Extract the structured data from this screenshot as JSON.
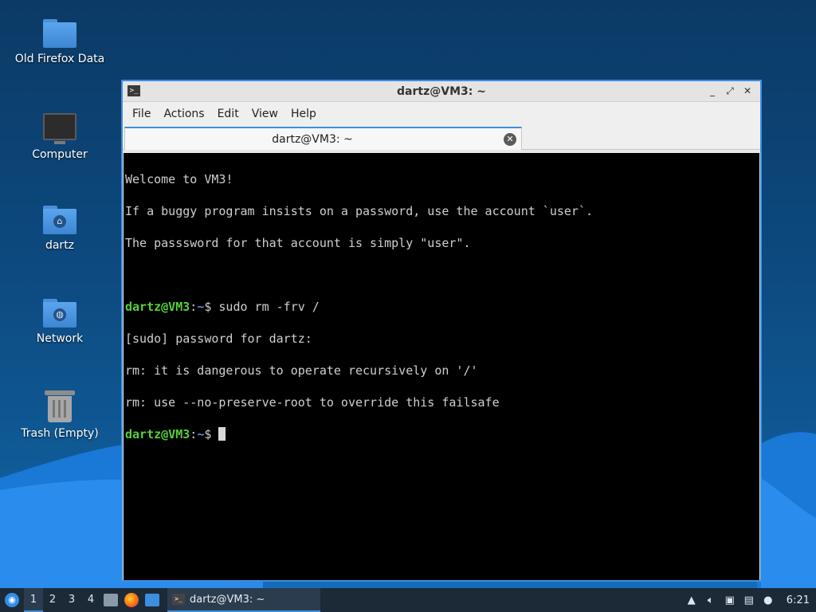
{
  "desktop": {
    "icons": [
      {
        "label": "Old Firefox Data",
        "icon": "folder-icon"
      },
      {
        "label": "Computer",
        "icon": "computer-icon"
      },
      {
        "label": "dartz",
        "icon": "home-folder-icon"
      },
      {
        "label": "Network",
        "icon": "network-folder-icon"
      },
      {
        "label": "Trash (Empty)",
        "icon": "trash-icon"
      }
    ]
  },
  "window": {
    "title": "dartz@VM3: ~",
    "menu": [
      "File",
      "Actions",
      "Edit",
      "View",
      "Help"
    ],
    "tab_label": "dartz@VM3: ~",
    "controls": {
      "minimize": "_",
      "maximize": "⤢",
      "close": "✕"
    }
  },
  "terminal": {
    "lines": [
      "Welcome to VM3!",
      "If a buggy program insists on a password, use the account `user`.",
      "The passsword for that account is simply \"user\".",
      "",
      "",
      "[sudo] password for dartz:",
      "rm: it is dangerous to operate recursively on '/'",
      "rm: use --no-preserve-root to override this failsafe"
    ],
    "prompt_user": "dartz@VM3",
    "prompt_sep": ":",
    "prompt_path": "~",
    "prompt_symbol": "$",
    "command_1": " sudo rm -frv /",
    "command_2": " "
  },
  "taskbar": {
    "workspaces": [
      "1",
      "2",
      "3",
      "4"
    ],
    "active_workspace": "1",
    "task_label": "dartz@VM3: ~",
    "clock": "6:21",
    "tray_icons": [
      "upload-icon",
      "volume-icon",
      "network-icon",
      "clipboard-icon",
      "notification-icon"
    ]
  },
  "colors": {
    "accent": "#3d8ee0",
    "prompt_user": "#55d13b",
    "prompt_path": "#5b8fe0",
    "terminal_bg": "#000000"
  }
}
